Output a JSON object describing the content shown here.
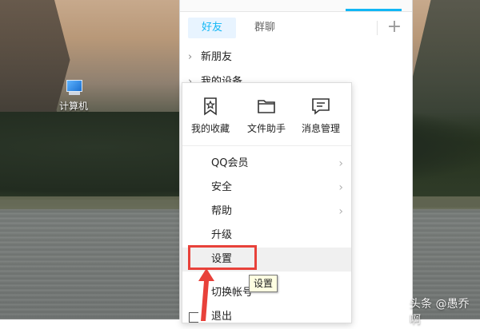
{
  "desktop": {
    "computer_label": "计算机"
  },
  "qq": {
    "tabs": {
      "friends": "好友",
      "groups": "群聊"
    },
    "groups": [
      {
        "label": "新朋友"
      },
      {
        "label": "我的设备"
      }
    ]
  },
  "menu": {
    "quick": [
      {
        "label": "我的收藏",
        "icon": "bookmark-icon"
      },
      {
        "label": "文件助手",
        "icon": "folder-icon"
      },
      {
        "label": "消息管理",
        "icon": "message-icon"
      }
    ],
    "items": [
      {
        "label": "QQ会员",
        "has_submenu": true
      },
      {
        "label": "安全",
        "has_submenu": true
      },
      {
        "label": "帮助",
        "has_submenu": true
      },
      {
        "label": "升级",
        "has_submenu": false
      },
      {
        "label": "设置",
        "has_submenu": false
      },
      {
        "label": "切换帐号",
        "has_submenu": false
      },
      {
        "label": "退出",
        "has_submenu": false
      }
    ]
  },
  "tooltip": {
    "text": "设置"
  },
  "watermark": {
    "text": "头条 @愚乔啊"
  },
  "colors": {
    "accent": "#12b7f5",
    "highlight_box": "#e8413a",
    "tooltip_bg": "#ffffe1"
  }
}
